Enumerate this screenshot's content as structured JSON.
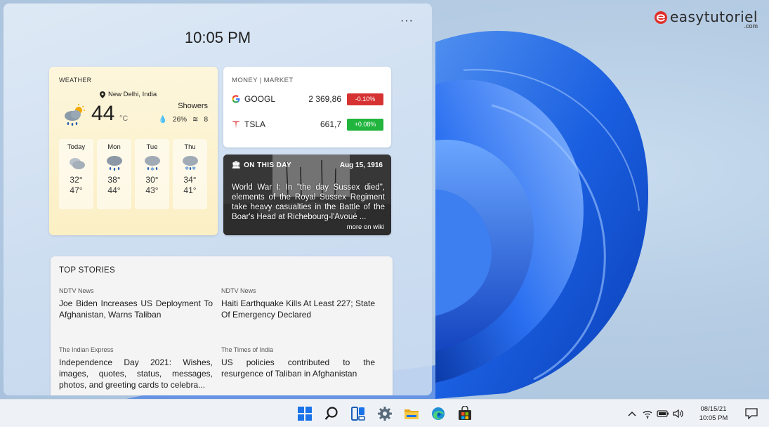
{
  "watermark": {
    "brand": "easytutoriel",
    "domain": ".com"
  },
  "panel": {
    "time": "10:05 PM",
    "more": "···"
  },
  "weather": {
    "title": "WEATHER",
    "location": "New Delhi, India",
    "temp": "44",
    "unit": "°C",
    "condition": "Showers",
    "humidity": "26%",
    "wind": "8",
    "days": [
      {
        "name": "Today",
        "high": "32°",
        "low": "47°",
        "icon": "cloudy-icon"
      },
      {
        "name": "Mon",
        "high": "38°",
        "low": "44°",
        "icon": "rain-icon"
      },
      {
        "name": "Tue",
        "high": "30°",
        "low": "43°",
        "icon": "sleet-icon"
      },
      {
        "name": "Thu",
        "high": "34°",
        "low": "41°",
        "icon": "snow-rain-icon"
      }
    ]
  },
  "money": {
    "title": "MONEY | MARKET",
    "stocks": [
      {
        "symbol": "GOOGL",
        "price": "2 369,86",
        "change": "-0.10%",
        "color": "#d63232"
      },
      {
        "symbol": "TSLA",
        "price": "661,7",
        "change": "+0.08%",
        "color": "#21b53d"
      }
    ]
  },
  "on_this_day": {
    "title": "ON THIS DAY",
    "date": "Aug 15, 1916",
    "text": "World War I: In \"the day Sussex died\", elements of the Royal Sussex Regiment take heavy casualties in the Battle of the Boar's Head at Richebourg-l'Avoué ...",
    "more": "more on wiki"
  },
  "top_stories": {
    "title": "TOP STORIES",
    "items": [
      {
        "source": "NDTV News",
        "headline": "Joe Biden Increases US Deployment To Afghanistan, Warns Taliban"
      },
      {
        "source": "NDTV News",
        "headline": "Haiti Earthquake Kills At Least 227; State Of Emergency Declared"
      },
      {
        "source": "The Indian Express",
        "headline": "Independence Day 2021: Wishes, images, quotes, status, messages, photos, and greeting cards to celebra..."
      },
      {
        "source": "The Times of India",
        "headline": "US policies contributed to the resurgence of Taliban in Afghanistan"
      }
    ]
  },
  "taskbar": {
    "apps": [
      "start-icon",
      "search-icon",
      "widgets-icon",
      "settings-icon",
      "file-explorer-icon",
      "edge-icon",
      "store-icon"
    ],
    "date": "08/15/21",
    "time": "10:05 PM"
  }
}
